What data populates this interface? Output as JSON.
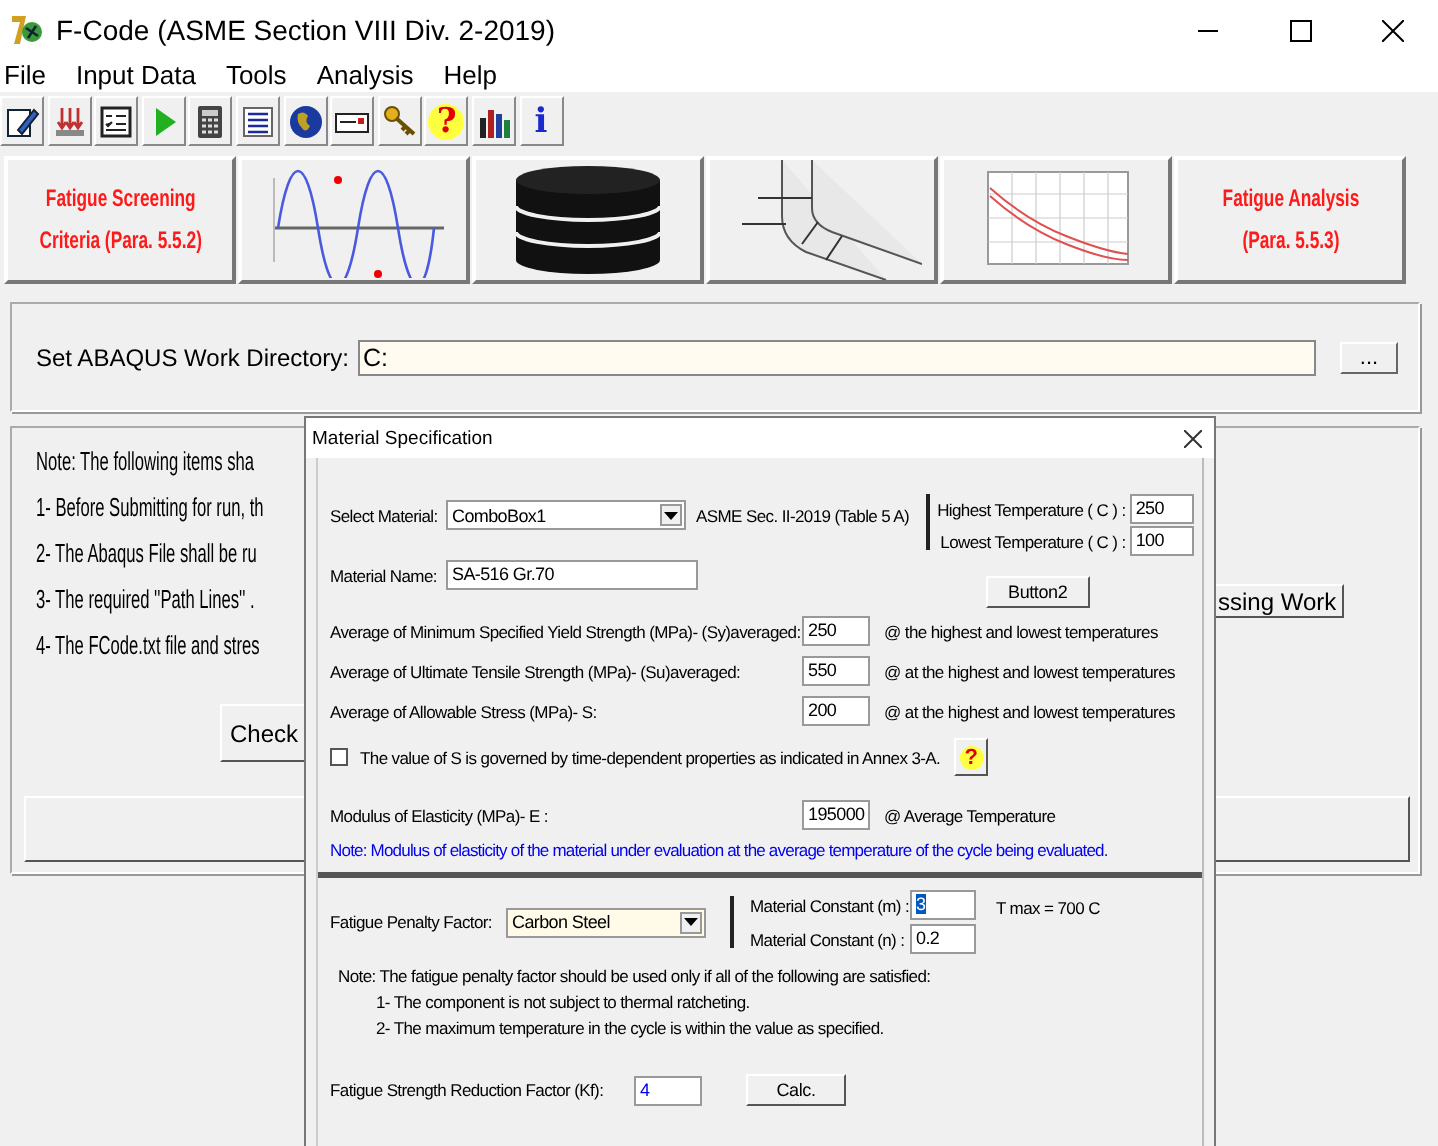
{
  "window": {
    "title": "F-Code (ASME Section VIII Div. 2-2019)"
  },
  "menu": [
    {
      "label": "File"
    },
    {
      "label": "Input Data"
    },
    {
      "label": "Tools"
    },
    {
      "label": "Analysis"
    },
    {
      "label": "Help"
    }
  ],
  "toolbar": [
    {
      "kind": "edit"
    },
    {
      "kind": "import"
    },
    {
      "kind": "checklist"
    },
    {
      "kind": "run"
    },
    {
      "kind": "calculator"
    },
    {
      "kind": "list"
    },
    {
      "kind": "globe"
    },
    {
      "kind": "card"
    },
    {
      "kind": "key"
    },
    {
      "kind": "help",
      "glyph": "?"
    },
    {
      "kind": "books"
    },
    {
      "kind": "info",
      "glyph": "i"
    }
  ],
  "modules": [
    {
      "kind": "text",
      "lines": [
        "Fatigue Screening",
        "Criteria (Para. 5.5.2)"
      ]
    },
    {
      "kind": "sine_chart"
    },
    {
      "kind": "database"
    },
    {
      "kind": "pipe_paths"
    },
    {
      "kind": "fatigue_curve"
    },
    {
      "kind": "text",
      "lines": [
        "Fatigue Analysis",
        "(Para. 5.5.3)"
      ]
    }
  ],
  "work_directory": {
    "label": "Set ABAQUS Work Directory:",
    "value": "C:",
    "browse": "..."
  },
  "notes": [
    "Note: The following items sha",
    "1- Before Submitting for run, th",
    "2- The Abaqus File shall be ru",
    "3- The required ''Path Lines'' .",
    "4- The FCode.txt file and stres"
  ],
  "buttons": [
    {
      "kind": "check",
      "label": "Check"
    },
    {
      "kind": "processing",
      "label": "ssing Work"
    }
  ],
  "dialog": {
    "title": "Material Specification",
    "select_material": {
      "label": "Select Material:",
      "value": "ComboBox1"
    },
    "standard": "ASME Sec. II-2019  (Table 5 A)",
    "highest_temperature": {
      "label": "Highest Temperature ( C ) :",
      "value": "250"
    },
    "lowest_temperature": {
      "label": "Lowest Temperature ( C ) :",
      "value": "100"
    },
    "button2": "Button2",
    "material_name": {
      "label": "Material Name:",
      "value": "SA-516 Gr.70"
    },
    "properties": [
      {
        "label": "Average of Minimum Specified Yield Strength (MPa)- (Sy)averaged:",
        "value": "250",
        "note": "@ the highest and lowest temperatures"
      },
      {
        "label": "Average of Ultimate Tensile Strength (MPa)- (Su)averaged:",
        "value": "550",
        "note": "@ at the highest and lowest temperatures"
      },
      {
        "label": "Average of Allowable Stress (MPa)- S:",
        "value": "200",
        "note": "@ at the highest and lowest temperatures"
      }
    ],
    "time_dependent": {
      "label": "The value of S is governed by time-dependent properties as indicated in Annex 3-A.",
      "checked": false,
      "help": "?"
    },
    "modulus": {
      "label": "Modulus of Elasticity (MPa)- E :",
      "value": "195000",
      "note": "@ Average Temperature"
    },
    "modulus_note": "Note: Modulus of elasticity of the material under evaluation at the average temperature of the cycle being evaluated.",
    "penalty": {
      "label": "Fatigue Penalty Factor:",
      "value": "Carbon Steel"
    },
    "constants": [
      {
        "label": "Material Constant (m) :",
        "value": "3",
        "text_selected": true
      },
      {
        "label": "Material Constant (n) :",
        "value": "0.2",
        "text_selected": false
      }
    ],
    "tmax": "T max = 700 C",
    "penalty_notes": [
      {
        "kind": "heading",
        "text": "Note: The fatigue penalty factor should be used only if all of the following are satisfied:"
      },
      {
        "kind": "item",
        "text": "1- The component is not subject to thermal ratcheting."
      },
      {
        "kind": "item",
        "text": "2- The maximum temperature in the cycle is within the value as specified."
      }
    ],
    "kf": {
      "label": "Fatigue Strength Reduction Factor (Kf):",
      "value": "4",
      "button": "Calc."
    }
  }
}
